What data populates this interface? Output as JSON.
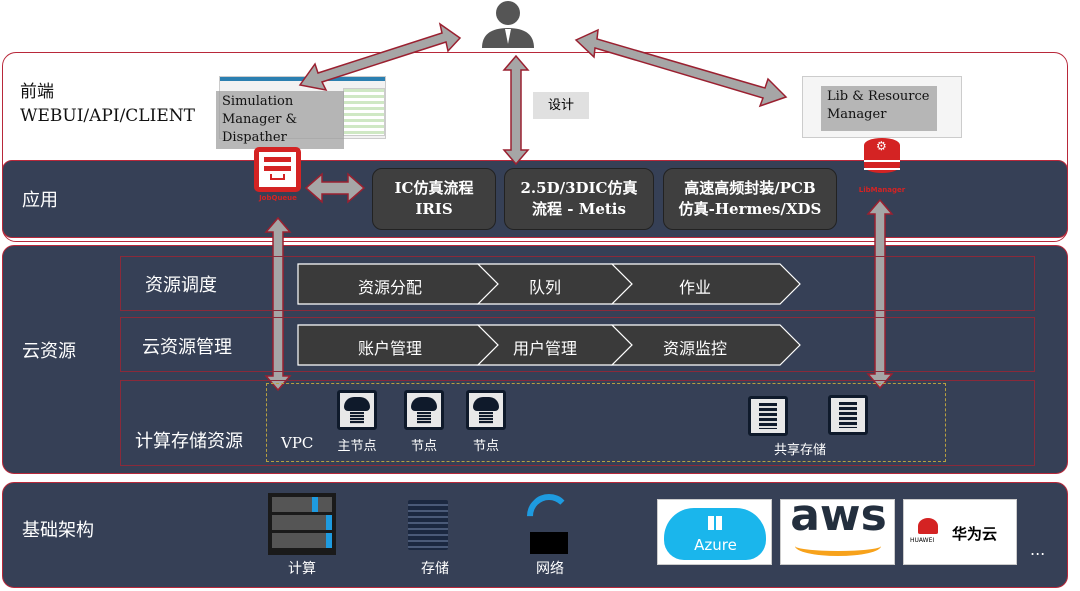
{
  "frontend": {
    "label_line1": "前端",
    "label_line2": "WEBUI/API/CLIENT",
    "sim_manager": "Simulation Manager & Dispather",
    "lib_manager": "Lib & Resource Manager",
    "design_label": "设计"
  },
  "app": {
    "label": "应用",
    "jobqueue": "JobQueue",
    "libmanager": "LibManager",
    "flows": [
      {
        "line1": "IC仿真流程",
        "line2": "IRIS"
      },
      {
        "line1": "2.5D/3DIC仿真",
        "line2": "流程 - Metis"
      },
      {
        "line1": "高速高频封装/PCB",
        "line2": "仿真-Hermes/XDS"
      }
    ]
  },
  "cloud": {
    "label": "云资源",
    "scheduling": {
      "label": "资源调度",
      "steps": [
        "资源分配",
        "队列",
        "作业"
      ]
    },
    "management": {
      "label": "云资源管理",
      "steps": [
        "账户管理",
        "用户管理",
        "资源监控"
      ]
    },
    "compute": {
      "label": "计算存储资源",
      "vpc": "VPC",
      "nodes": [
        "主节点",
        "节点",
        "节点"
      ],
      "shared_storage": "共享存储"
    }
  },
  "infra": {
    "label": "基础架构",
    "items": [
      "计算",
      "存储",
      "网络"
    ],
    "providers": [
      "Azure",
      "aws",
      "HUAWEI",
      "华为云"
    ],
    "more": "..."
  },
  "colors": {
    "navy": "#364056",
    "border_red": "#b8283a",
    "brand_red": "#d42323",
    "arrow_gray": "#a6a6a6"
  }
}
